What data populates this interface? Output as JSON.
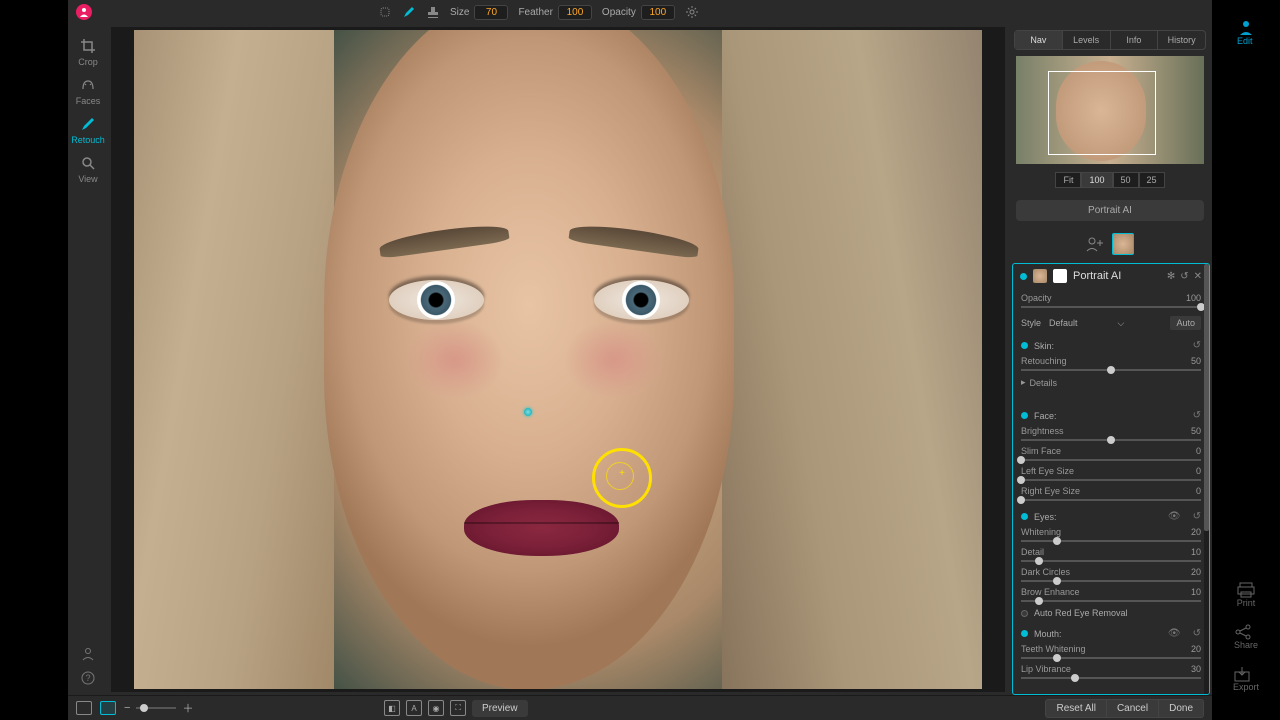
{
  "top": {
    "size_label": "Size",
    "size_value": "70",
    "feather_label": "Feather",
    "feather_value": "100",
    "opacity_label": "Opacity",
    "opacity_value": "100"
  },
  "left_tools": {
    "crop": "Crop",
    "faces": "Faces",
    "retouch": "Retouch",
    "view": "View"
  },
  "right_tabs": {
    "nav": "Nav",
    "levels": "Levels",
    "info": "Info",
    "history": "History"
  },
  "zoom": {
    "fit": "Fit",
    "z100": "100",
    "z50": "50",
    "z25": "25"
  },
  "portrait_ai_button": "Portrait AI",
  "panel": {
    "title": "Portrait AI",
    "opacity": {
      "label": "Opacity",
      "value": "100"
    },
    "style": {
      "label": "Style",
      "value": "Default",
      "auto": "Auto"
    },
    "skin": {
      "label": "Skin:",
      "retouching": {
        "label": "Retouching",
        "value": "50"
      },
      "details": "Details"
    },
    "face": {
      "label": "Face:",
      "brightness": {
        "label": "Brightness",
        "value": "50"
      },
      "slim": {
        "label": "Slim Face",
        "value": "0"
      },
      "leye": {
        "label": "Left Eye Size",
        "value": "0"
      },
      "reye": {
        "label": "Right Eye Size",
        "value": "0"
      }
    },
    "eyes": {
      "label": "Eyes:",
      "whitening": {
        "label": "Whitening",
        "value": "20"
      },
      "detail": {
        "label": "Detail",
        "value": "10"
      },
      "dark": {
        "label": "Dark Circles",
        "value": "20"
      },
      "brow": {
        "label": "Brow Enhance",
        "value": "10"
      },
      "auto_red": "Auto Red Eye Removal"
    },
    "mouth": {
      "label": "Mouth:",
      "teeth": {
        "label": "Teeth Whitening",
        "value": "20"
      },
      "lip": {
        "label": "Lip Vibrance",
        "value": "30"
      }
    }
  },
  "bottom": {
    "preview": "Preview",
    "reset": "Reset All",
    "cancel": "Cancel",
    "done": "Done"
  },
  "rside": {
    "edit": "Edit",
    "print": "Print",
    "share": "Share",
    "export": "Export"
  }
}
